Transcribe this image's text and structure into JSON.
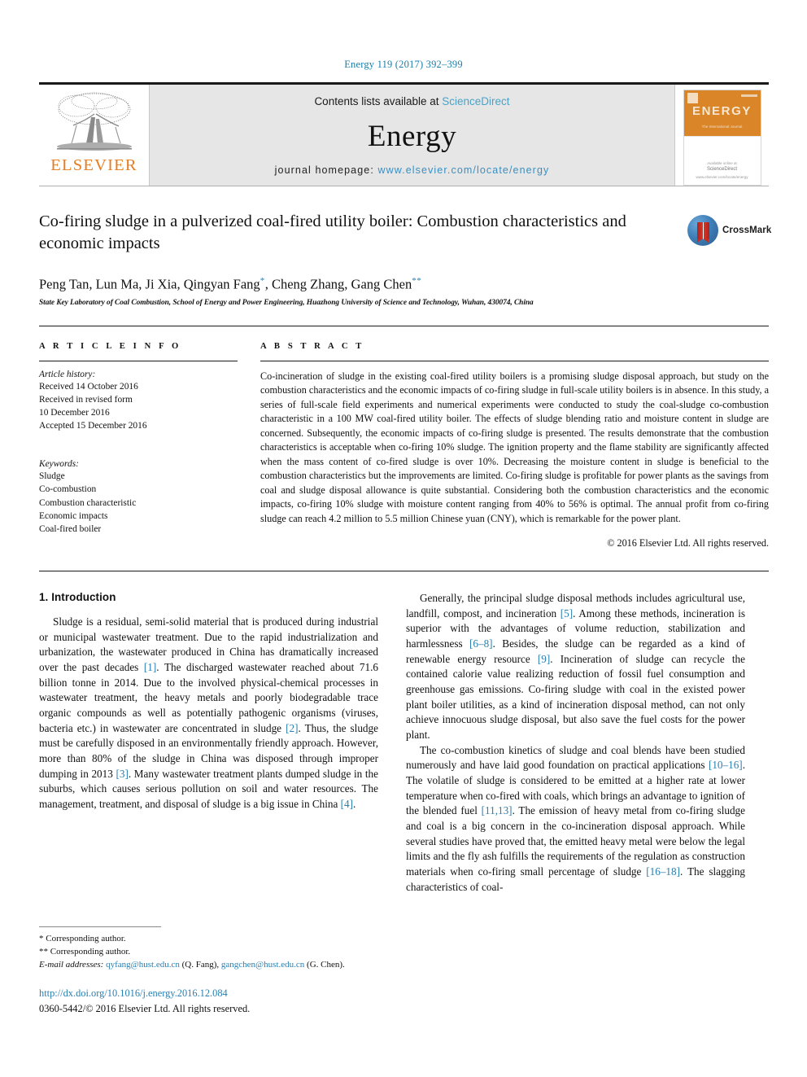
{
  "journal_ref": "Energy 119 (2017) 392–399",
  "masthead": {
    "publisher_name": "ELSEVIER",
    "contents_prefix": "Contents lists available at ",
    "contents_link": "ScienceDirect",
    "journal_name": "Energy",
    "homepage_label": "journal homepage: ",
    "homepage_url": "www.elsevier.com/locate/energy",
    "cover": {
      "title": "ENERGY",
      "subtitle": "The International Journal",
      "footer_line1": "Available online at",
      "footer_line2": "ScienceDirect",
      "footer_line3": "www.elsevier.com/locate/energy"
    }
  },
  "article": {
    "title": "Co-firing sludge in a pulverized coal-fired utility boiler: Combustion characteristics and economic impacts",
    "crossmark_label": "CrossMark",
    "authors_parts": [
      {
        "text": "Peng Tan, Lun Ma, Ji Xia, Qingyan Fang",
        "sup": ""
      },
      {
        "text": "",
        "sup": "*"
      },
      {
        "text": ", Cheng Zhang, Gang Chen",
        "sup": ""
      },
      {
        "text": "",
        "sup": "**"
      }
    ],
    "authors_plain": "Peng Tan, Lun Ma, Ji Xia, Qingyan Fang*, Cheng Zhang, Gang Chen**",
    "affiliation": "State Key Laboratory of Coal Combustion, School of Energy and Power Engineering, Huazhong University of Science and Technology, Wuhan, 430074, China"
  },
  "article_info": {
    "heading": "A R T I C L E   I N F O",
    "history_label": "Article history:",
    "history": [
      "Received 14 October 2016",
      "Received in revised form",
      "10 December 2016",
      "Accepted 15 December 2016"
    ],
    "keywords_label": "Keywords:",
    "keywords": [
      "Sludge",
      "Co-combustion",
      "Combustion characteristic",
      "Economic impacts",
      "Coal-fired boiler"
    ]
  },
  "abstract": {
    "heading": "A B S T R A C T",
    "text": "Co-incineration of sludge in the existing coal-fired utility boilers is a promising sludge disposal approach, but study on the combustion characteristics and the economic impacts of co-firing sludge in full-scale utility boilers is in absence. In this study, a series of full-scale field experiments and numerical experiments were conducted to study the coal-sludge co-combustion characteristic in a 100 MW coal-fired utility boiler. The effects of sludge blending ratio and moisture content in sludge are concerned. Subsequently, the economic impacts of co-firing sludge is presented. The results demonstrate that the combustion characteristics is acceptable when co-firing 10% sludge. The ignition property and the flame stability are significantly affected when the mass content of co-fired sludge is over 10%. Decreasing the moisture content in sludge is beneficial to the combustion characteristics but the improvements are limited. Co-firing sludge is profitable for power plants as the savings from coal and sludge disposal allowance is quite substantial. Considering both the combustion characteristics and the economic impacts, co-firing 10% sludge with moisture content ranging from 40% to 56% is optimal. The annual profit from co-firing sludge can reach 4.2 million to 5.5 million Chinese yuan (CNY), which is remarkable for the power plant.",
    "copyright": "© 2016 Elsevier Ltd. All rights reserved."
  },
  "body": {
    "section_title": "1. Introduction",
    "left_paragraphs": [
      "Sludge is a residual, semi-solid material that is produced during industrial or municipal wastewater treatment. Due to the rapid industrialization and urbanization, the wastewater produced in China has dramatically increased over the past decades [1]. The discharged wastewater reached about 71.6 billion tonne in 2014. Due to the involved physical-chemical processes in wastewater treatment, the heavy metals and poorly biodegradable trace organic compounds as well as potentially pathogenic organisms (viruses, bacteria etc.) in wastewater are concentrated in sludge [2]. Thus, the sludge must be carefully disposed in an environmentally friendly approach. However, more than 80% of the sludge in China was disposed through improper dumping in 2013 [3]. Many wastewater treatment plants dumped sludge in the suburbs, which causes serious pollution on soil and water resources. The management, treatment, and disposal of sludge is a big issue in China [4]."
    ],
    "right_paragraphs": [
      "Generally, the principal sludge disposal methods includes agricultural use, landfill, compost, and incineration [5]. Among these methods, incineration is superior with the advantages of volume reduction, stabilization and harmlessness [6–8]. Besides, the sludge can be regarded as a kind of renewable energy resource [9]. Incineration of sludge can recycle the contained calorie value realizing reduction of fossil fuel consumption and greenhouse gas emissions. Co-firing sludge with coal in the existed power plant boiler utilities, as a kind of incineration disposal method, can not only achieve innocuous sludge disposal, but also save the fuel costs for the power plant.",
      "The co-combustion kinetics of sludge and coal blends have been studied numerously and have laid good foundation on practical applications [10–16]. The volatile of sludge is considered to be emitted at a higher rate at lower temperature when co-fired with coals, which brings an advantage to ignition of the blended fuel [11,13]. The emission of heavy metal from co-firing sludge and coal is a big concern in the co-incineration disposal approach. While several studies have proved that, the emitted heavy metal were below the legal limits and the fly ash fulfills the requirements of the regulation as construction materials when co-firing small percentage of sludge [16–18]. The slagging characteristics of coal-"
    ]
  },
  "footnotes": {
    "star_line": "Corresponding author.",
    "doublestar_line": "Corresponding author.",
    "email_label": "E-mail addresses:",
    "email_1": "qyfang@hust.edu.cn",
    "email_1_owner": "(Q. Fang)",
    "email_2": "gangchen@hust.edu.cn",
    "email_2_owner": "(G. Chen).",
    "doi": "http://dx.doi.org/10.1016/j.energy.2016.12.084",
    "issn": "0360-5442/© 2016 Elsevier Ltd. All rights reserved."
  },
  "colors": {
    "link_blue": "#2a7fb0",
    "elsevier_orange": "#E87C1E",
    "masthead_gray": "#e6e6e6",
    "cover_orange": "#D98528"
  }
}
